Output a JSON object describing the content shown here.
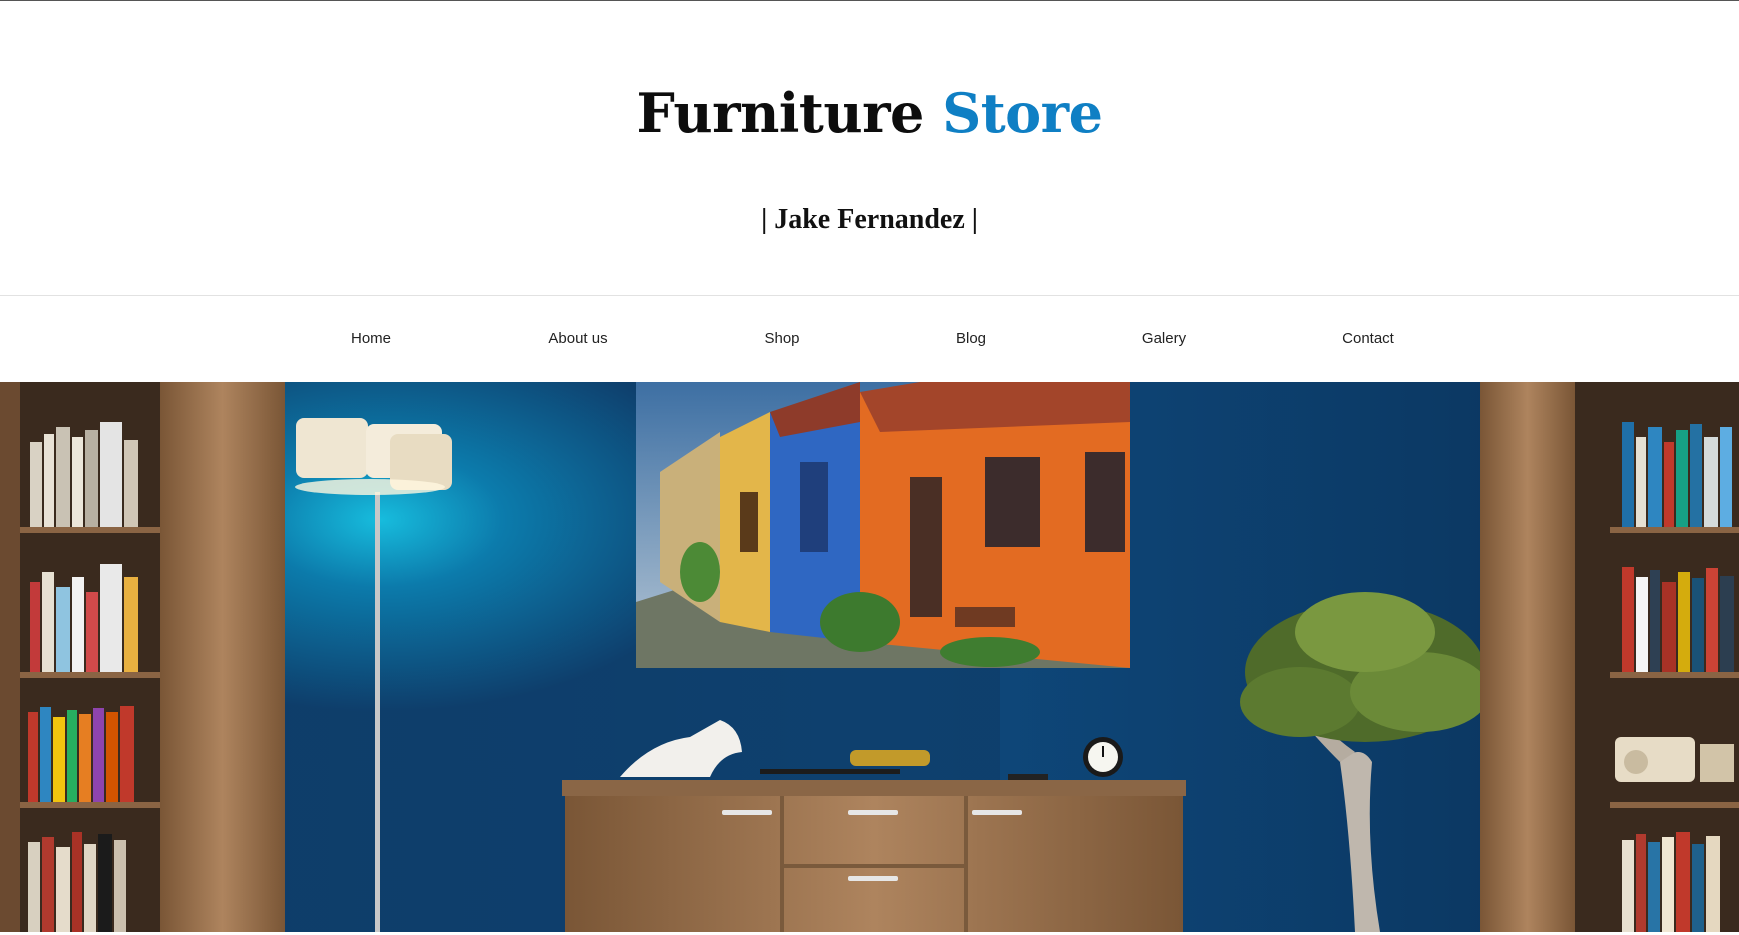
{
  "header": {
    "brand_word1": "Furniture",
    "brand_word2": "Store",
    "owner": "| Jake Fernandez |"
  },
  "nav": {
    "items": [
      {
        "label": "Home"
      },
      {
        "label": "About us"
      },
      {
        "label": "Shop"
      },
      {
        "label": "Blog"
      },
      {
        "label": "Galery"
      },
      {
        "label": "Contact"
      }
    ]
  },
  "colors": {
    "accent": "#0f7fc4",
    "wall": "#0e3e6b",
    "wood": "#a57b56"
  },
  "hero": {
    "image": "living-room-blue-wall"
  }
}
